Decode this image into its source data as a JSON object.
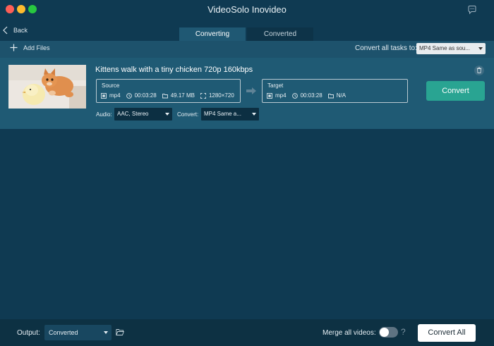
{
  "window": {
    "title": "VideoSolo Inovideo"
  },
  "nav": {
    "back_label": "Back",
    "tabs": [
      {
        "label": "Converting",
        "active": true
      },
      {
        "label": "Converted",
        "active": false
      }
    ]
  },
  "toolbar": {
    "add_files_label": "Add Files",
    "convert_all_label": "Convert all tasks to:",
    "convert_all_value": "MP4 Same as sou..."
  },
  "task": {
    "title": "Kittens walk with a tiny chicken 720p 160kbps",
    "source": {
      "label": "Source",
      "format": "mp4",
      "duration": "00:03:28",
      "size": "49.17 MB",
      "resolution": "1280×720"
    },
    "target": {
      "label": "Target",
      "format": "mp4",
      "duration": "00:03:28",
      "size": "N/A"
    },
    "audio_label": "Audio:",
    "audio_value": "AAC, Stereo",
    "convert_label": "Convert:",
    "convert_value": "MP4 Same a...",
    "convert_button": "Convert"
  },
  "footer": {
    "output_label": "Output:",
    "output_value": "Converted",
    "merge_label": "Merge all videos:",
    "merge_enabled": false,
    "help_glyph": "?",
    "convert_all_button": "Convert All"
  },
  "colors": {
    "background": "#0f3a52",
    "task_row": "#1f5a74",
    "accent_convert": "#29a492",
    "footer": "#0d3143"
  }
}
